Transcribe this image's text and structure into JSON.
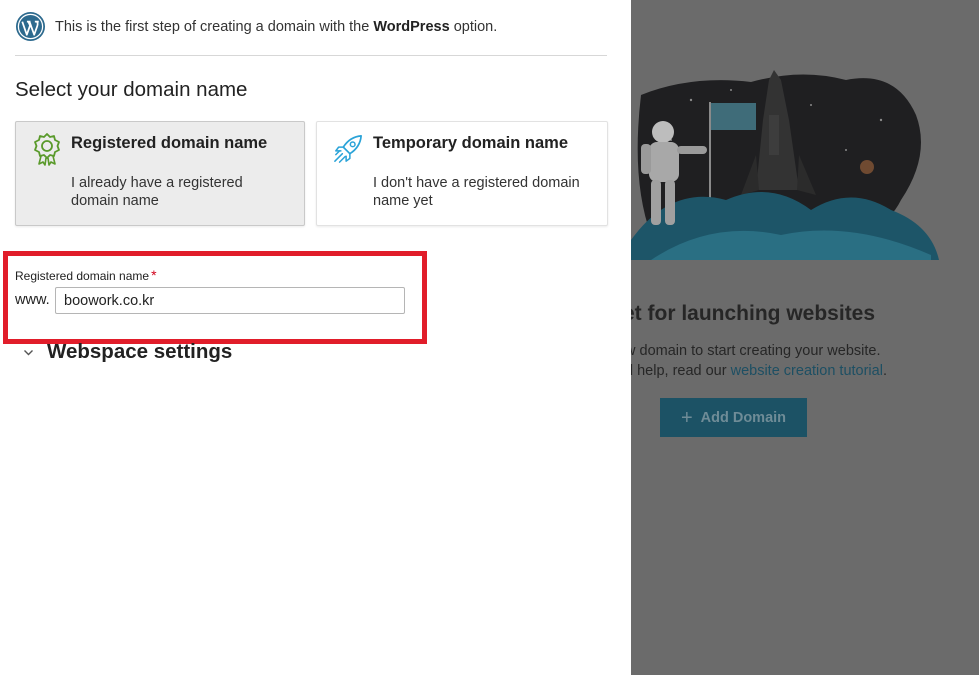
{
  "notice": {
    "prefix": "This is the first step of creating a domain with the",
    "bold": "WordPress",
    "suffix": "option."
  },
  "section_title": "Select your domain name",
  "cards": [
    {
      "title": "Registered domain name",
      "description": "I already have a registered domain name",
      "selected": true,
      "icon": "certificate-badge-icon"
    },
    {
      "title": "Temporary domain name",
      "description": "I don't have a registered domain name yet",
      "selected": false,
      "icon": "rocket-icon"
    }
  ],
  "domain_field": {
    "label": "Registered domain name",
    "required_mark": "*",
    "prefix": "www.",
    "value": "boowork.co.kr"
  },
  "webspace": {
    "label": "Webspace settings",
    "icon": "chevron-down-icon"
  },
  "background_page": {
    "heading": "et for launching websites",
    "line1": "w domain to start creating your website.",
    "line2_prefix": "d help, read our",
    "line2_link": "website creation tutorial",
    "line2_suffix": ".",
    "add_button_label": "Add Domain",
    "add_button_icon": "+"
  },
  "colors": {
    "highlight": "#e11d2a",
    "accent_green": "#5a9a2b",
    "accent_blue": "#2aa3d8",
    "overlay": "#6b6b6b"
  }
}
